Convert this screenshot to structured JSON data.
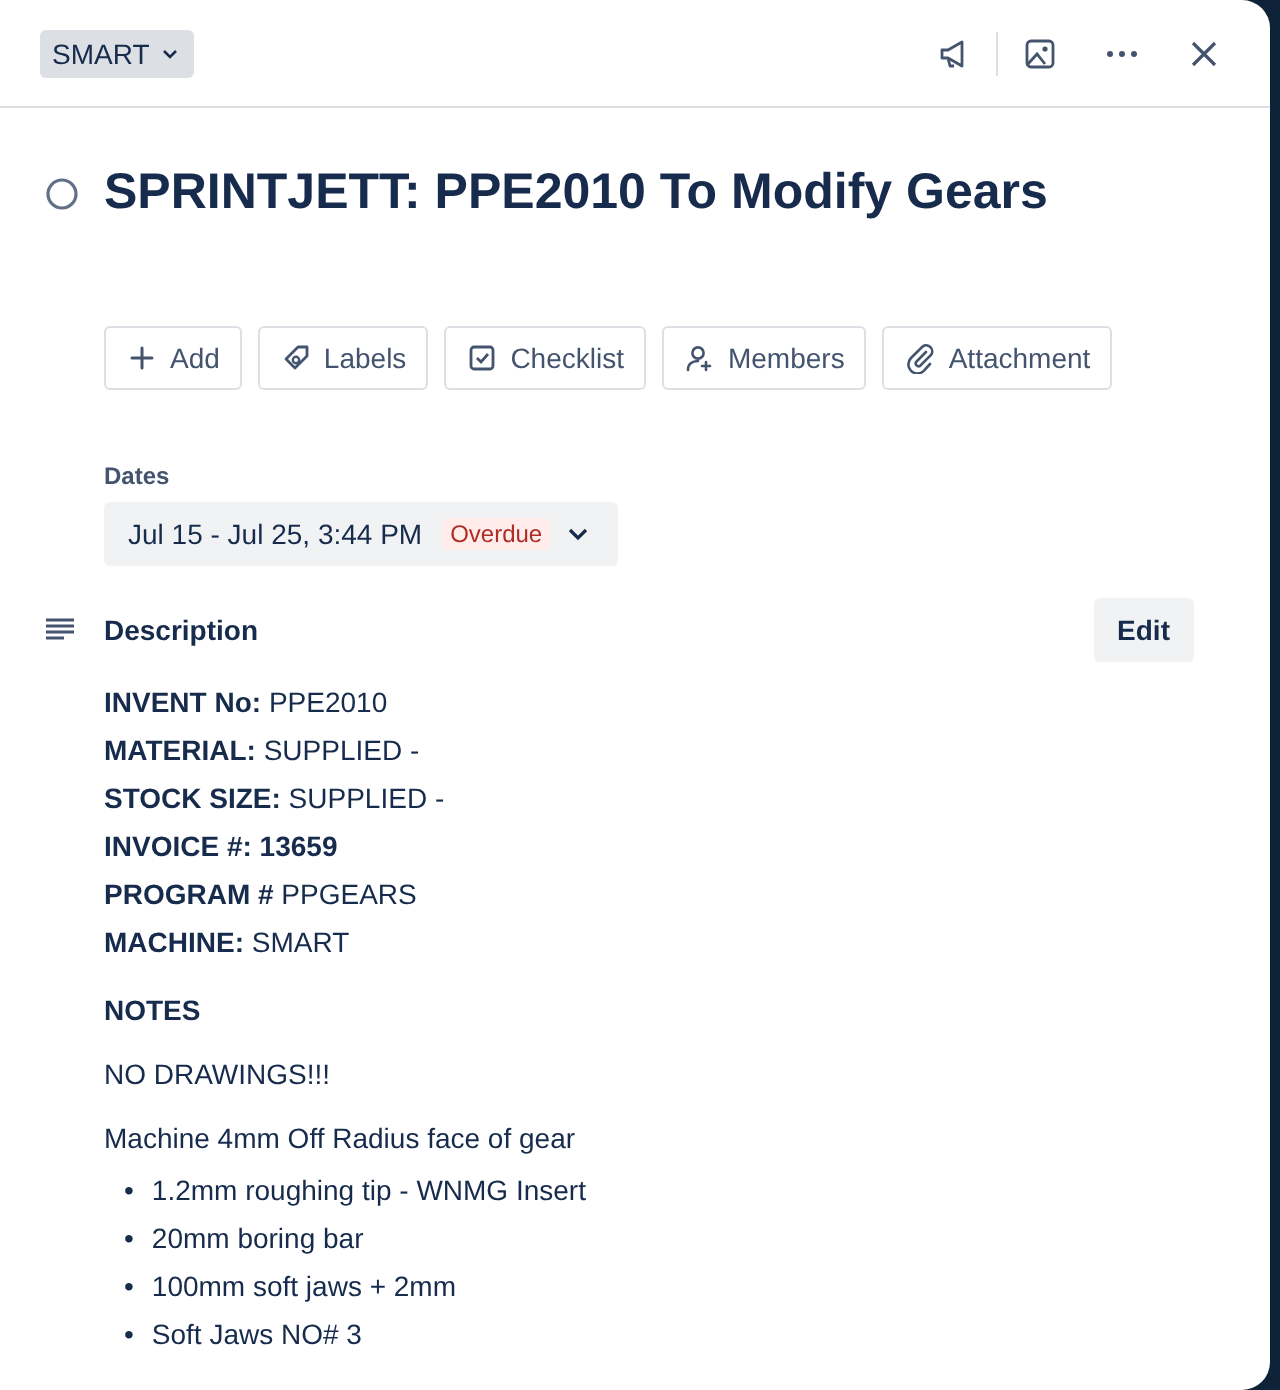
{
  "header": {
    "list_name": "SMART"
  },
  "card": {
    "title": "SPRINTJETT: PPE2010 To Modify Gears",
    "completed": false
  },
  "actions": [
    {
      "kind": "add",
      "label": "Add"
    },
    {
      "kind": "labels",
      "label": "Labels"
    },
    {
      "kind": "checklist",
      "label": "Checklist"
    },
    {
      "kind": "members",
      "label": "Members"
    },
    {
      "kind": "attachment",
      "label": "Attachment"
    }
  ],
  "dates": {
    "heading": "Dates",
    "value": "Jul 15 - Jul 25, 3:44 PM",
    "status": "Overdue"
  },
  "description": {
    "heading": "Description",
    "edit_button": "Edit",
    "blocks": [
      {
        "kind": "lines",
        "lines": [
          {
            "text": "**INVENT No:** PPE2010",
            "bold": false
          },
          {
            "text": "**MATERIAL:** SUPPLIED -",
            "bold": false
          },
          {
            "text": "**STOCK SIZE:** SUPPLIED -",
            "bold": false
          },
          {
            "text": "INVOICE #: 13659",
            "bold": true
          },
          {
            "text": "**PROGRAM #** PPGEARS",
            "bold": false
          },
          {
            "text": "**MACHINE:** SMART",
            "bold": false
          }
        ]
      },
      {
        "kind": "paragraph",
        "text": "NOTES",
        "bold": true
      },
      {
        "kind": "paragraph",
        "text": "NO DRAWINGS!!!",
        "bold": false
      },
      {
        "kind": "paragraph",
        "text": "Machine 4mm Off Radius face of gear",
        "bold": false
      },
      {
        "kind": "list",
        "items": [
          {
            "marker": "•",
            "text": "1.2mm roughing tip - WNMG Insert"
          },
          {
            "marker": "•",
            "text": "20mm boring bar"
          },
          {
            "marker": "•",
            "text": "100mm soft jaws + 2mm"
          },
          {
            "marker": "•",
            "text": "Soft Jaws NO# 3"
          }
        ]
      }
    ]
  }
}
